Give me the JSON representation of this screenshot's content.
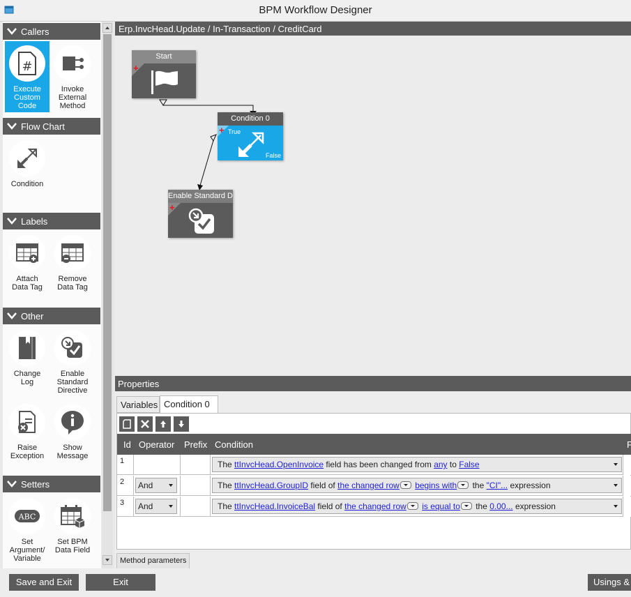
{
  "window": {
    "title": "BPM Workflow Designer"
  },
  "toolbox": {
    "sections": [
      {
        "label": "Callers",
        "items": [
          {
            "label": "Execute Custom Code",
            "lines": [
              "Execute",
              "Custom",
              "Code"
            ],
            "icon": "code-file-icon",
            "selected": true
          },
          {
            "label": "Invoke External Method",
            "lines": [
              "Invoke",
              "External",
              "Method"
            ],
            "icon": "external-method-icon"
          }
        ]
      },
      {
        "label": "Flow Chart",
        "items": [
          {
            "label": "Condition",
            "lines": [
              "Condition"
            ],
            "icon": "condition-arrows-icon"
          }
        ]
      },
      {
        "label": "Labels",
        "items": [
          {
            "label": "Attach Data Tag",
            "lines": [
              "Attach",
              "Data Tag"
            ],
            "icon": "attach-tag-icon"
          },
          {
            "label": "Remove Data Tag",
            "lines": [
              "Remove",
              "Data Tag"
            ],
            "icon": "remove-tag-icon"
          }
        ]
      },
      {
        "label": "Other",
        "items": [
          {
            "label": "Change Log",
            "lines": [
              "Change",
              "Log"
            ],
            "icon": "book-icon"
          },
          {
            "label": "Enable Standard Directive",
            "lines": [
              "Enable",
              "Standard",
              "Directive"
            ],
            "icon": "enable-directive-icon"
          },
          {
            "label": "Raise Exception",
            "lines": [
              "Raise",
              "Exception"
            ],
            "icon": "raise-exception-icon"
          },
          {
            "label": "Show Message",
            "lines": [
              "Show",
              "Message"
            ],
            "icon": "info-bubble-icon"
          }
        ]
      },
      {
        "label": "Setters",
        "items": [
          {
            "label": "Set Argument/ Variable",
            "lines": [
              "Set",
              "Argument/",
              "Variable"
            ],
            "icon": "abc-icon"
          },
          {
            "label": "Set BPM Data Field",
            "lines": [
              "Set BPM",
              "Data Field"
            ],
            "icon": "calendar-field-icon"
          }
        ]
      }
    ]
  },
  "canvas": {
    "path": "Erp.InvcHead.Update / In-Transaction / CreditCard",
    "nodes": {
      "start": {
        "title": "Start"
      },
      "condition": {
        "title": "Condition 0",
        "true_label": "True",
        "false_label": "False"
      },
      "enable": {
        "title": "Enable Standard D"
      }
    }
  },
  "properties": {
    "title": "Properties",
    "tabs": [
      "Variables",
      "Condition 0"
    ],
    "active_tab": "Condition 0",
    "columns": {
      "id": "Id",
      "operator": "Operator",
      "prefix": "Prefix",
      "condition": "Condition",
      "extra": "P"
    },
    "rows": [
      {
        "id": "1",
        "operator": "",
        "parts": {
          "t1": "The ",
          "field": "ttInvcHead.OpenInvoice",
          "t2": " field has been changed from ",
          "from": "any",
          "t3": " to ",
          "to": "False"
        }
      },
      {
        "id": "2",
        "operator": "And",
        "parts": {
          "t1": "The ",
          "field": "ttInvcHead.GroupID",
          "t2": " field of ",
          "row": "the changed row",
          "op": "begins with",
          "t3": " the ",
          "value": "\"CI\"...",
          "t4": " expression"
        }
      },
      {
        "id": "3",
        "operator": "And",
        "parts": {
          "t1": "The ",
          "field": "ttInvcHead.InvoiceBal",
          "t2": " field of ",
          "row": "the changed row",
          "op": "is equal to",
          "t3": " the ",
          "value": "0.00...",
          "t4": " expression"
        }
      }
    ],
    "method_tab": "Method parameters"
  },
  "footer": {
    "save_exit": "Save and Exit",
    "exit": "Exit",
    "usings": "Usings &"
  },
  "colors": {
    "dark": "#5b5b5b",
    "accent": "#1aa7e8",
    "link": "#1f1fd8",
    "plus": "#e8131b"
  }
}
